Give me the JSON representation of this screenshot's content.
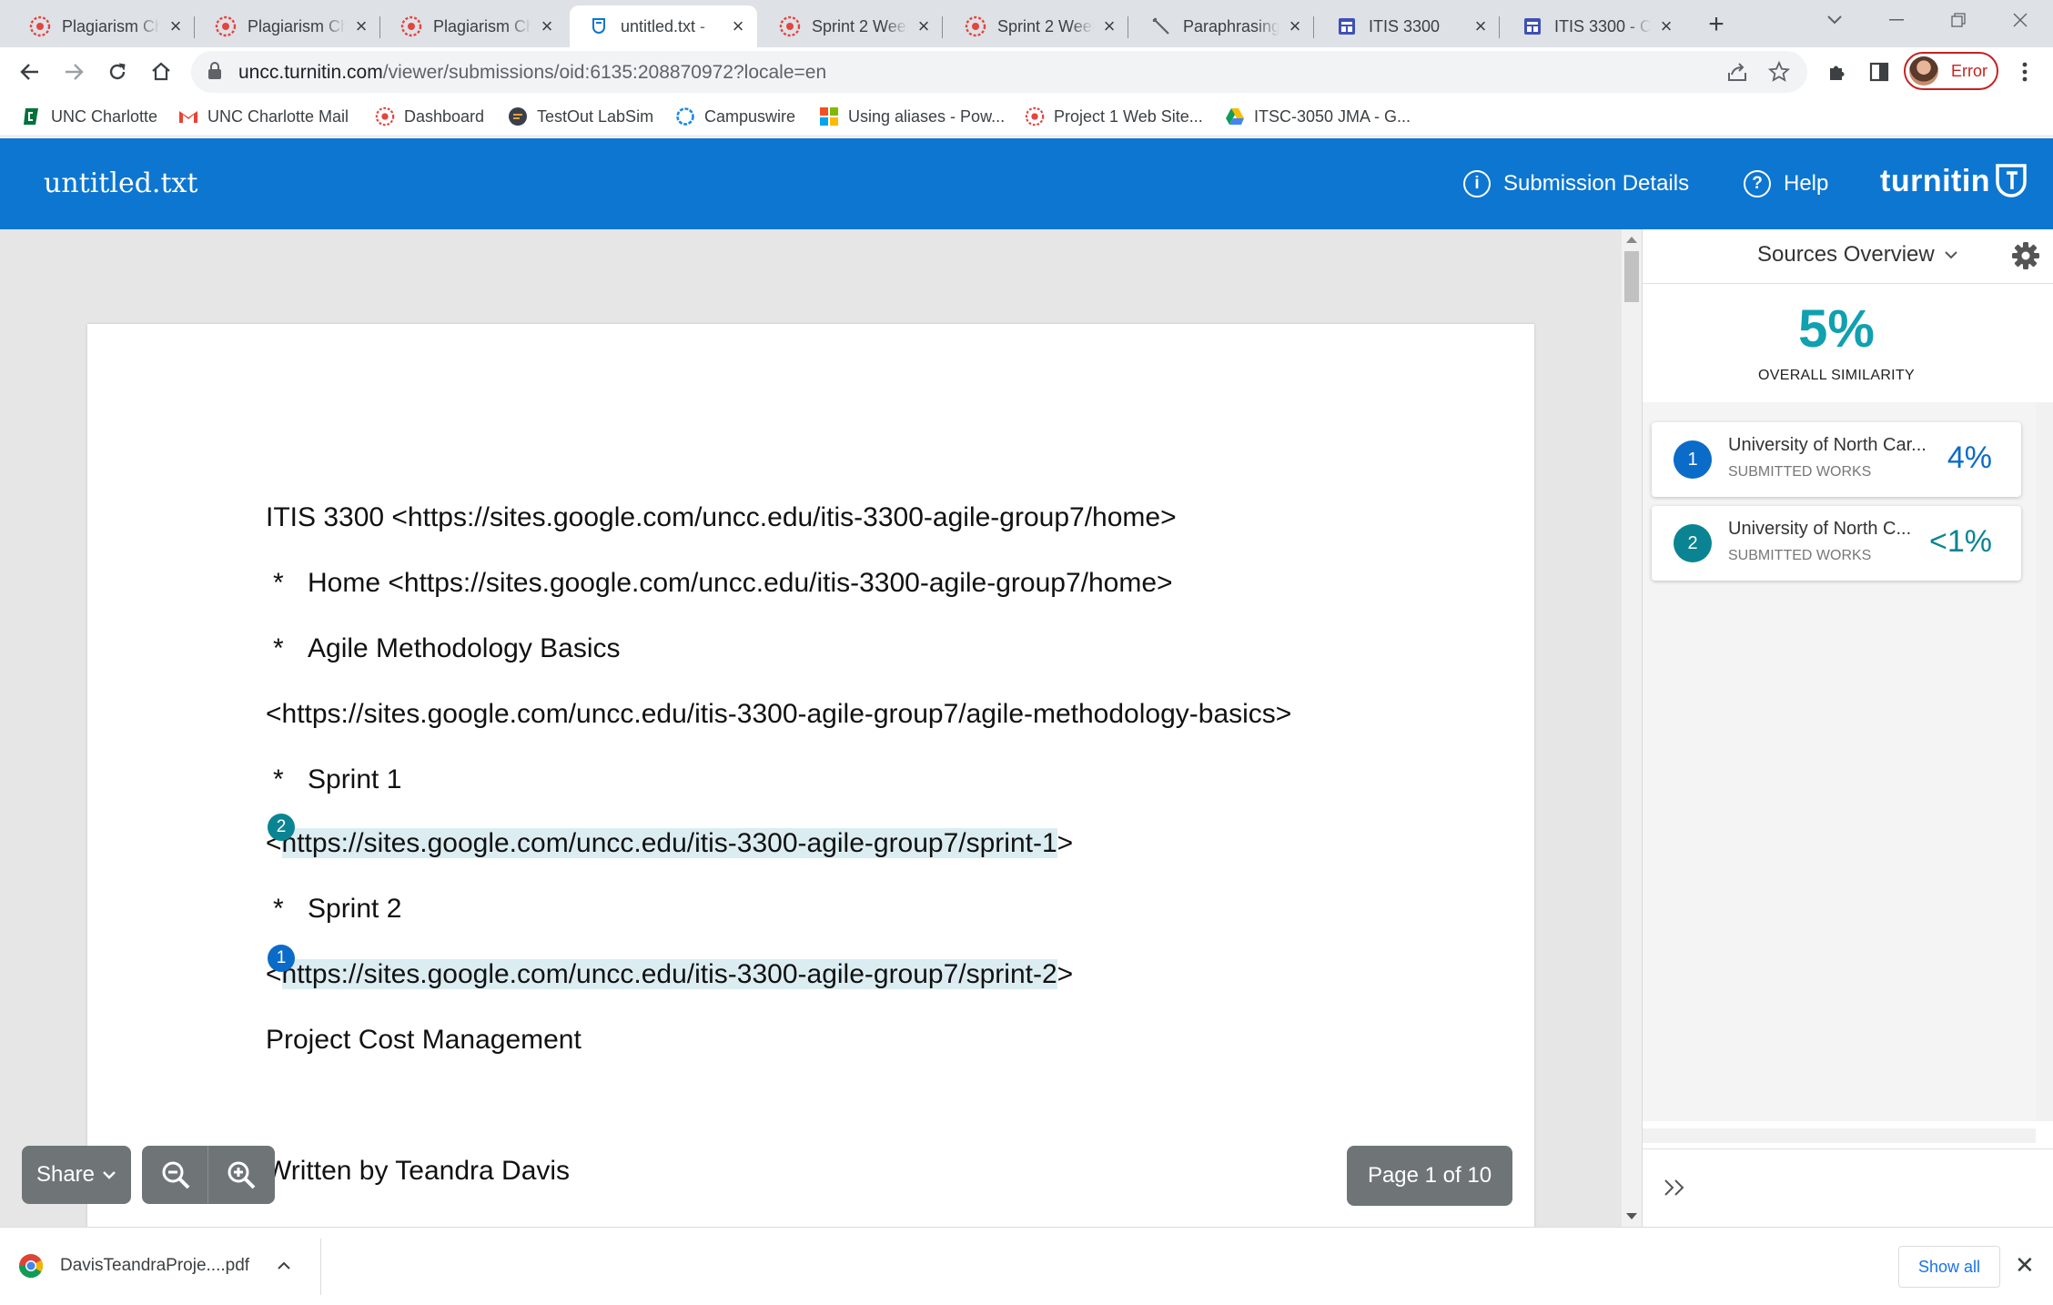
{
  "browser": {
    "tabs": [
      {
        "title": "Plagiarism Ch",
        "icon": "lms-icon",
        "active": false
      },
      {
        "title": "Plagiarism Ch",
        "icon": "lms-icon",
        "active": false
      },
      {
        "title": "Plagiarism Ch",
        "icon": "lms-icon",
        "active": false
      },
      {
        "title": "untitled.txt - ",
        "icon": "turnitin-icon",
        "active": true
      },
      {
        "title": "Sprint 2 Week",
        "icon": "lms-icon",
        "active": false
      },
      {
        "title": "Sprint 2 Week",
        "icon": "lms-icon",
        "active": false
      },
      {
        "title": "Paraphrasing",
        "icon": "pen-icon",
        "active": false
      },
      {
        "title": "ITIS 3300",
        "icon": "sites-icon",
        "active": false
      },
      {
        "title": "ITIS 3300 - Co",
        "icon": "sites-icon",
        "active": false
      }
    ],
    "url_host": "uncc.turnitin.com",
    "url_path": "/viewer/submissions/oid:6135:208870972?locale=en",
    "profile_status": "Error",
    "bookmarks": [
      {
        "label": "UNC Charlotte",
        "icon": "unc-icon"
      },
      {
        "label": "UNC Charlotte Mail",
        "icon": "gmail-icon"
      },
      {
        "label": "Dashboard",
        "icon": "lms-icon"
      },
      {
        "label": "TestOut LabSim",
        "icon": "testout-icon"
      },
      {
        "label": "Campuswire",
        "icon": "campuswire-icon"
      },
      {
        "label": "Using aliases - Pow...",
        "icon": "microsoft-icon"
      },
      {
        "label": "Project 1 Web Site...",
        "icon": "lms-icon"
      },
      {
        "label": "ITSC-3050 JMA - G...",
        "icon": "drive-icon"
      }
    ]
  },
  "viewer": {
    "doc_title": "untitled.txt",
    "submission_details": "Submission Details",
    "help": "Help",
    "logo": "turnitin",
    "lines": [
      "ITIS 3300 <https://sites.google.com/uncc.edu/itis-3300-agile-group7/home>",
      "Home <https://sites.google.com/uncc.edu/itis-3300-agile-group7/home>",
      "Agile Methodology Basics",
      "<https://sites.google.com/uncc.edu/itis-3300-agile-group7/agile-methodology-basics>",
      "Sprint 1",
      "https://sites.google.com/uncc.edu/itis-3300-agile-group7/sprint-1",
      "Sprint 2",
      "https://sites.google.com/uncc.edu/itis-3300-agile-group7/sprint-2",
      "Project Cost Management",
      "Written by Teandra Davis"
    ],
    "bullet": "*",
    "lt": "<",
    "gt": ">",
    "share": "Share",
    "page_indicator": "Page 1 of 10"
  },
  "sources": {
    "title": "Sources Overview",
    "overall_pct": "5%",
    "overall_label": "OVERALL SIMILARITY",
    "items": [
      {
        "num": "1",
        "name": "University of North Car...",
        "type": "SUBMITTED WORKS",
        "pct": "4%",
        "color": "#0b6bc8"
      },
      {
        "num": "2",
        "name": "University of North C...",
        "type": "SUBMITTED WORKS",
        "pct": "<1%",
        "color": "#0a8492"
      }
    ]
  },
  "downloads": {
    "file": "DavisTeandraProje....pdf",
    "show_all": "Show all"
  }
}
